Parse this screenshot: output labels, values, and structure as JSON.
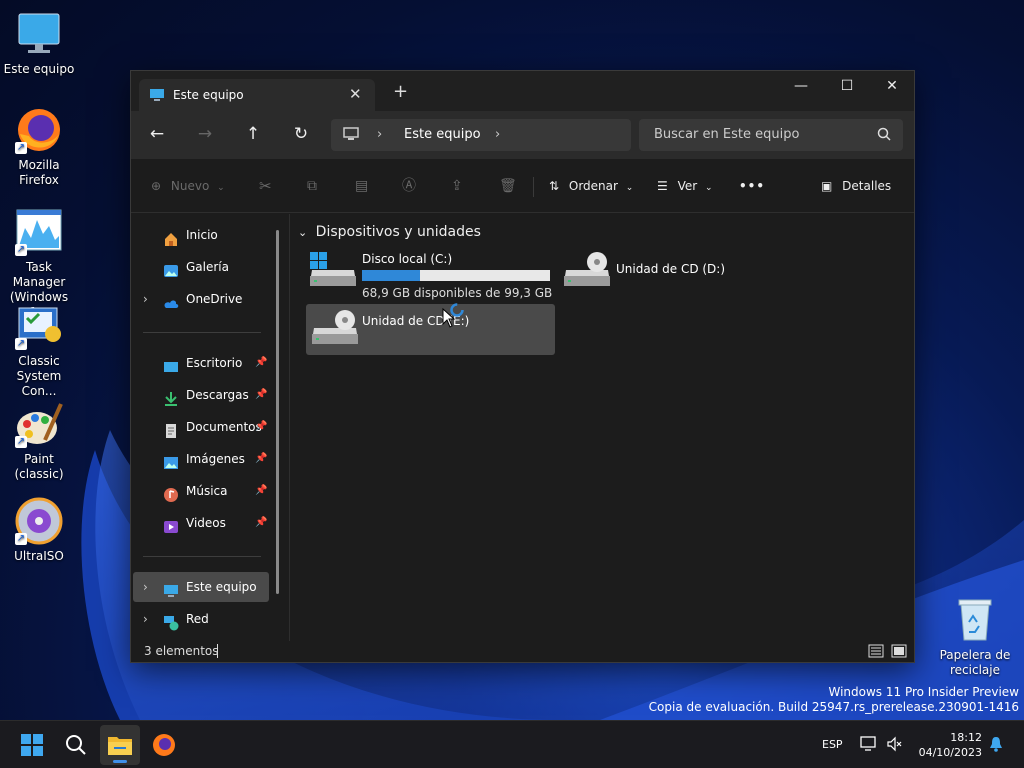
{
  "desktop": {
    "icons": [
      {
        "label": "Este equipo",
        "icon": "monitor-icon"
      },
      {
        "label": "Mozilla Firefox",
        "icon": "firefox-icon"
      },
      {
        "label": "Task Manager (Windows 1...",
        "icon": "task-manager-icon"
      },
      {
        "label": "Classic System Con...",
        "icon": "control-panel-icon"
      },
      {
        "label": "Paint (classic)",
        "icon": "paint-icon"
      },
      {
        "label": "UltraISO",
        "icon": "ultraiso-icon"
      }
    ],
    "recycle_bin": {
      "label": "Papelera de reciclaje",
      "icon": "recycle-bin-icon"
    }
  },
  "window": {
    "tab_title": "Este equipo",
    "new_tab": "+",
    "controls": {
      "minimize": "—",
      "maximize": "☐",
      "close": "✕"
    },
    "address": {
      "crumb": "Este equipo"
    },
    "search": {
      "placeholder": "Buscar en Este equipo"
    },
    "toolbar": {
      "new_label": "Nuevo",
      "sort_label": "Ordenar",
      "view_label": "Ver",
      "more": "•••",
      "details_label": "Detalles"
    },
    "sidebar": {
      "top": [
        {
          "label": "Inicio",
          "icon": "home-icon"
        },
        {
          "label": "Galería",
          "icon": "gallery-icon"
        },
        {
          "label": "OneDrive",
          "icon": "onedrive-icon"
        }
      ],
      "pinned": [
        {
          "label": "Escritorio",
          "icon": "desktop-folder-icon"
        },
        {
          "label": "Descargas",
          "icon": "downloads-icon"
        },
        {
          "label": "Documentos",
          "icon": "documents-icon"
        },
        {
          "label": "Imágenes",
          "icon": "pictures-icon"
        },
        {
          "label": "Música",
          "icon": "music-icon"
        },
        {
          "label": "Videos",
          "icon": "videos-icon"
        }
      ],
      "bottom": [
        {
          "label": "Este equipo",
          "icon": "this-pc-icon",
          "selected": true
        },
        {
          "label": "Red",
          "icon": "network-icon"
        }
      ]
    },
    "content": {
      "group_title": "Dispositivos y unidades",
      "drives": [
        {
          "name": "Disco local (C:)",
          "free_text": "68,9 GB disponibles de 99,3 GB",
          "used_fraction": 0.306
        },
        {
          "name": "Unidad de CD (D:)"
        },
        {
          "name": "Unidad de CD (E:)"
        }
      ]
    },
    "status": {
      "count": "3 elementos"
    }
  },
  "watermark": {
    "line1": "Windows 11 Pro Insider Preview",
    "line2": "Copia de evaluación. Build 25947.rs_prerelease.230901-1416"
  },
  "taskbar": {
    "lang": "ESP",
    "time": "18:12",
    "date": "04/10/2023"
  },
  "colors": {
    "accent": "#2f88d8",
    "window_bg": "#1c1c1c",
    "chrome_bg": "#2b2b2b"
  }
}
